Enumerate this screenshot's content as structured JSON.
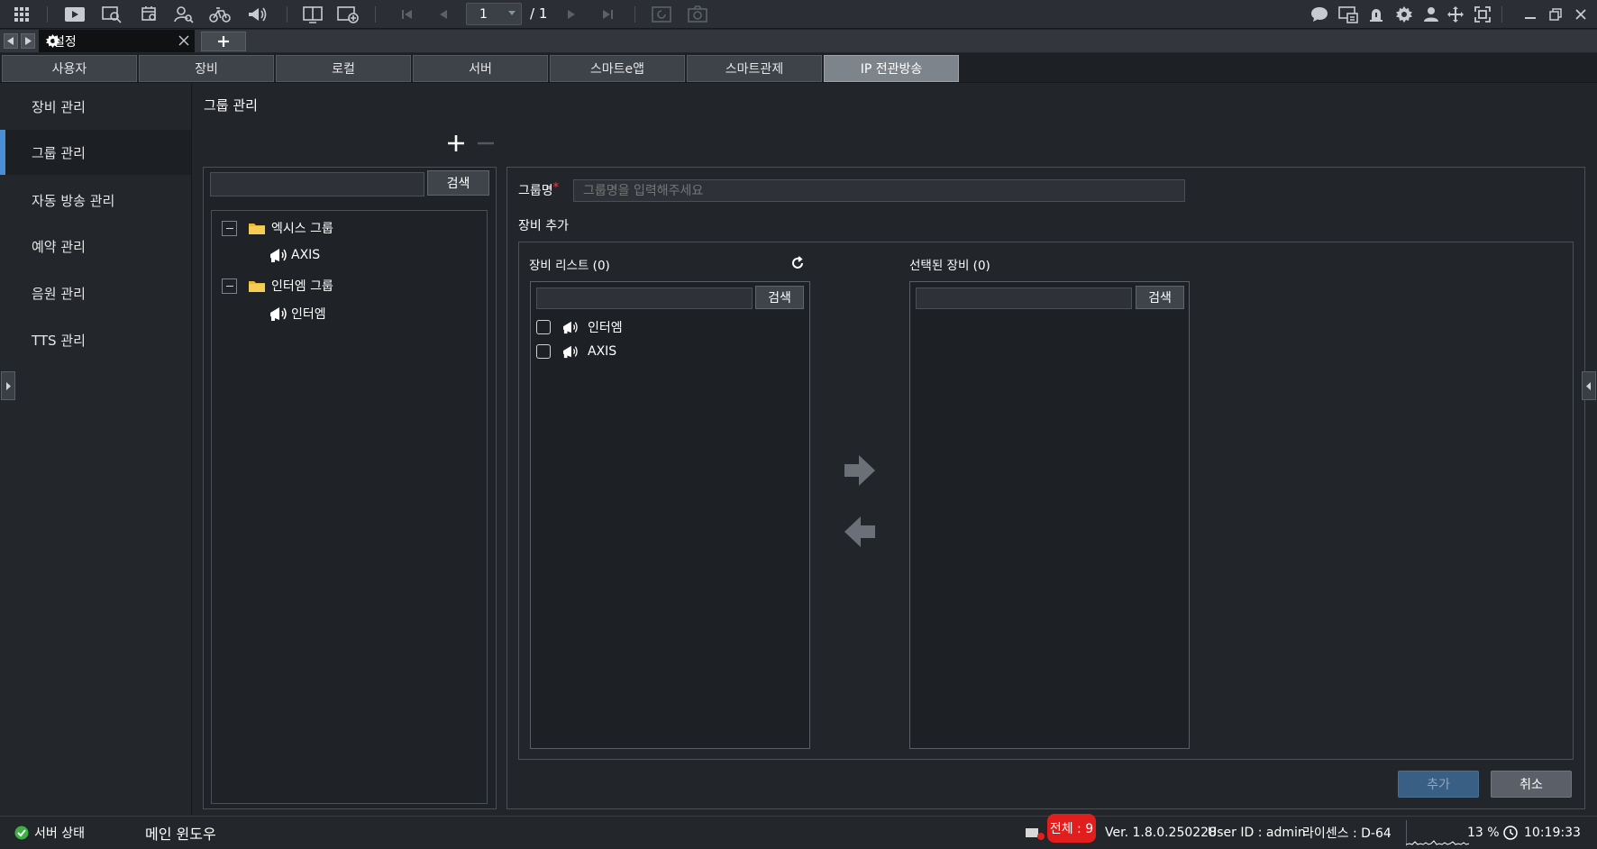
{
  "toolbar": {
    "icons": [
      "grid-icon",
      "play-icon",
      "search-video-icon",
      "event-search-icon",
      "person-search-icon",
      "bike-icon",
      "broadcast-icon",
      "layout-icon",
      "add-screen-icon",
      "first-page-icon",
      "prev-page-icon",
      "next-page-icon",
      "last-page-icon",
      "sequence-icon",
      "snapshot-icon",
      "chat-icon",
      "monitor-icon",
      "alarm-icon",
      "settings-icon",
      "user-icon",
      "move-icon",
      "fullscreen-icon",
      "minimize-icon",
      "restore-icon",
      "close-icon"
    ],
    "page_current": "1",
    "page_total": "/ 1"
  },
  "tabs": {
    "active_title": "설정",
    "add_label": "+"
  },
  "subtabs": [
    "사용자",
    "장비",
    "로컬",
    "서버",
    "스마트e앱",
    "스마트관제",
    "IP 전관방송"
  ],
  "active_subtab": "IP 전관방송",
  "sidebar": {
    "items": [
      {
        "label": "장비 관리"
      },
      {
        "label": "그룹 관리"
      },
      {
        "label": "자동 방송 관리"
      },
      {
        "label": "예약 관리"
      },
      {
        "label": "음원 관리"
      },
      {
        "label": "TTS 관리"
      }
    ],
    "active_item": "그룹 관리"
  },
  "page": {
    "title": "그룹 관리"
  },
  "tree": {
    "search_button": "검색",
    "groups": [
      {
        "name": "엑시스 그룹",
        "children": [
          "AXIS"
        ]
      },
      {
        "name": "인터엠 그룹",
        "children": [
          "인터엠"
        ]
      }
    ]
  },
  "form": {
    "group_name_label": "그룹명",
    "required_mark": "*",
    "group_name_placeholder": "그룹명을 입력해주세요",
    "group_name_value": "",
    "device_add_label": "장비 추가"
  },
  "device_list": {
    "title": "장비 리스트 (0)",
    "search_button": "검색",
    "items": [
      "인터엠",
      "AXIS"
    ]
  },
  "selected_list": {
    "title": "선택된 장비 (0)",
    "search_button": "검색",
    "items": []
  },
  "actions": {
    "add": "추가",
    "cancel": "취소"
  },
  "status": {
    "server_status": "서버 상태",
    "main_window": "메인 윈도우",
    "total": "전체 : 9",
    "version": "Ver. 1.8.0.250228",
    "user_id": "User ID : admin",
    "license": "라이센스 : D-64",
    "cpu": "13 %",
    "time": "10:19:33"
  },
  "colors": {
    "accent": "#4a8fd6",
    "alert": "#e11d1d",
    "add_button": "#3f6f9c",
    "ok_green": "#3cb043"
  }
}
